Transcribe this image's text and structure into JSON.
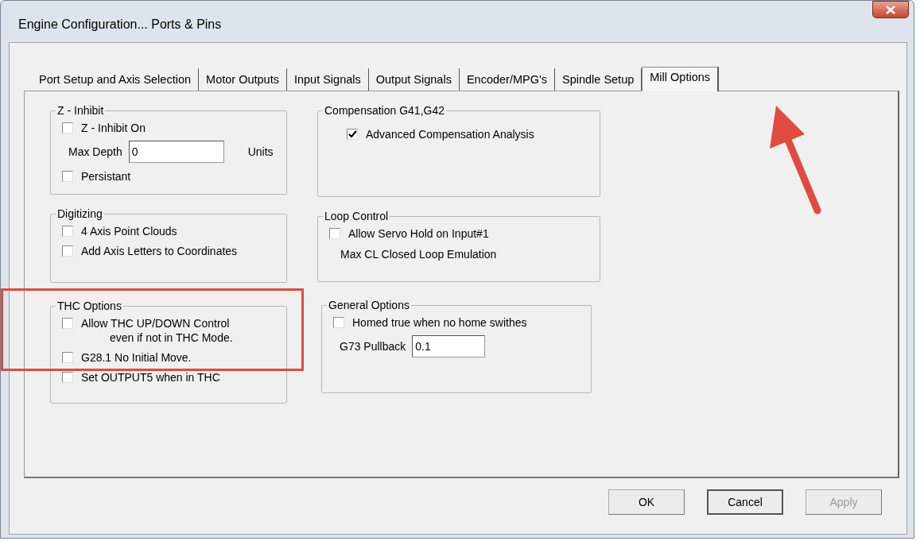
{
  "window": {
    "title": "Engine Configuration... Ports & Pins"
  },
  "tabs": [
    {
      "label": "Port Setup and Axis Selection",
      "selected": false
    },
    {
      "label": "Motor Outputs",
      "selected": false
    },
    {
      "label": "Input Signals",
      "selected": false
    },
    {
      "label": "Output Signals",
      "selected": false
    },
    {
      "label": "Encoder/MPG's",
      "selected": false
    },
    {
      "label": "Spindle Setup",
      "selected": false
    },
    {
      "label": "Mill Options",
      "selected": true
    }
  ],
  "left_groups": [
    {
      "title": "Z - Inhibit",
      "items": [
        {
          "kind": "checkbox",
          "lines": [
            "Z - Inhibit On"
          ],
          "checked": false
        },
        {
          "kind": "field",
          "label": "Max Depth",
          "value": "0",
          "unit": "Units"
        },
        {
          "kind": "checkbox",
          "lines": [
            "Persistant"
          ],
          "checked": false
        }
      ]
    },
    {
      "title": "Digitizing",
      "items": [
        {
          "kind": "checkbox",
          "lines": [
            "4 Axis Point Clouds"
          ],
          "checked": false
        },
        {
          "kind": "checkbox",
          "lines": [
            "Add Axis Letters to Coordinates"
          ],
          "checked": false
        }
      ]
    },
    {
      "title": "THC Options",
      "items": [
        {
          "kind": "checkbox",
          "lines": [
            "Allow THC UP/DOWN Control",
            "even if not in THC Mode."
          ],
          "checked": false
        },
        {
          "kind": "checkbox",
          "lines": [
            "G28.1 No Initial Move."
          ],
          "checked": false
        },
        {
          "kind": "checkbox",
          "lines": [
            "Set OUTPUT5 when in THC"
          ],
          "checked": false
        }
      ]
    }
  ],
  "right_groups": [
    {
      "title": "Compensation G41,G42",
      "items": [
        {
          "kind": "checkbox",
          "lines": [
            "Advanced Compensation Analysis"
          ],
          "checked": true
        }
      ]
    },
    {
      "title": "Loop Control",
      "items": [
        {
          "kind": "checkbox",
          "lines": [
            "Allow Servo Hold on Input#1"
          ],
          "checked": false
        },
        {
          "kind": "text",
          "text": "Max CL Closed Loop Emulation"
        }
      ]
    },
    {
      "title": "General Options",
      "items": [
        {
          "kind": "checkbox",
          "lines": [
            "Homed true when no home swithes"
          ],
          "checked": false
        },
        {
          "kind": "field",
          "label": "G73 Pullback",
          "value": "0.1"
        }
      ]
    }
  ],
  "buttons": [
    {
      "label": "OK",
      "disabled": false,
      "default": false
    },
    {
      "label": "Cancel",
      "disabled": false,
      "default": true
    },
    {
      "label": "Apply",
      "disabled": true,
      "default": false
    }
  ],
  "annotations": {
    "highlight": true,
    "arrow": true
  }
}
